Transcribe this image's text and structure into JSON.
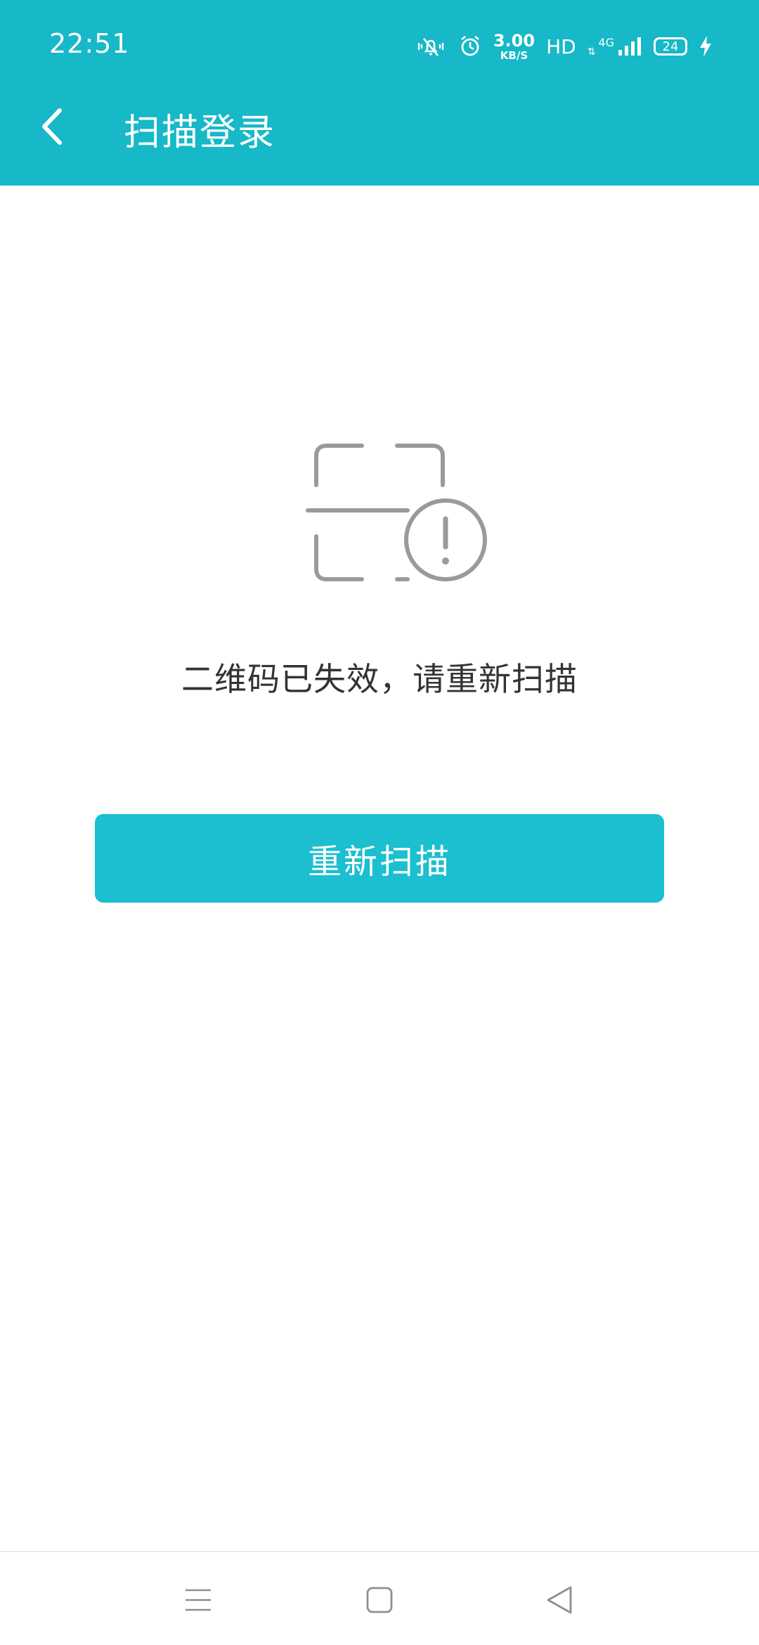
{
  "status_bar": {
    "time": "22:51",
    "net_speed_value": "3.00",
    "net_speed_unit": "KB/S",
    "hd_label": "HD",
    "network_type": "4G",
    "battery_level": "24",
    "icons": [
      "vibrate-mute-icon",
      "alarm-icon",
      "signal-icon",
      "battery-icon",
      "charging-icon"
    ]
  },
  "app_bar": {
    "title": "扫描登录",
    "back_icon": "chevron-left-icon"
  },
  "main": {
    "illustration_icon": "qr-scan-error-icon",
    "message": "二维码已失效，请重新扫描",
    "rescan_button_label": "重新扫描"
  },
  "nav_bar": {
    "items": [
      "menu-icon",
      "home-icon",
      "back-triangle-icon"
    ]
  },
  "colors": {
    "accent": "#17b8c7",
    "button": "#1bbfcf",
    "illustration_gray": "#9a9a9a",
    "text": "#333333"
  }
}
